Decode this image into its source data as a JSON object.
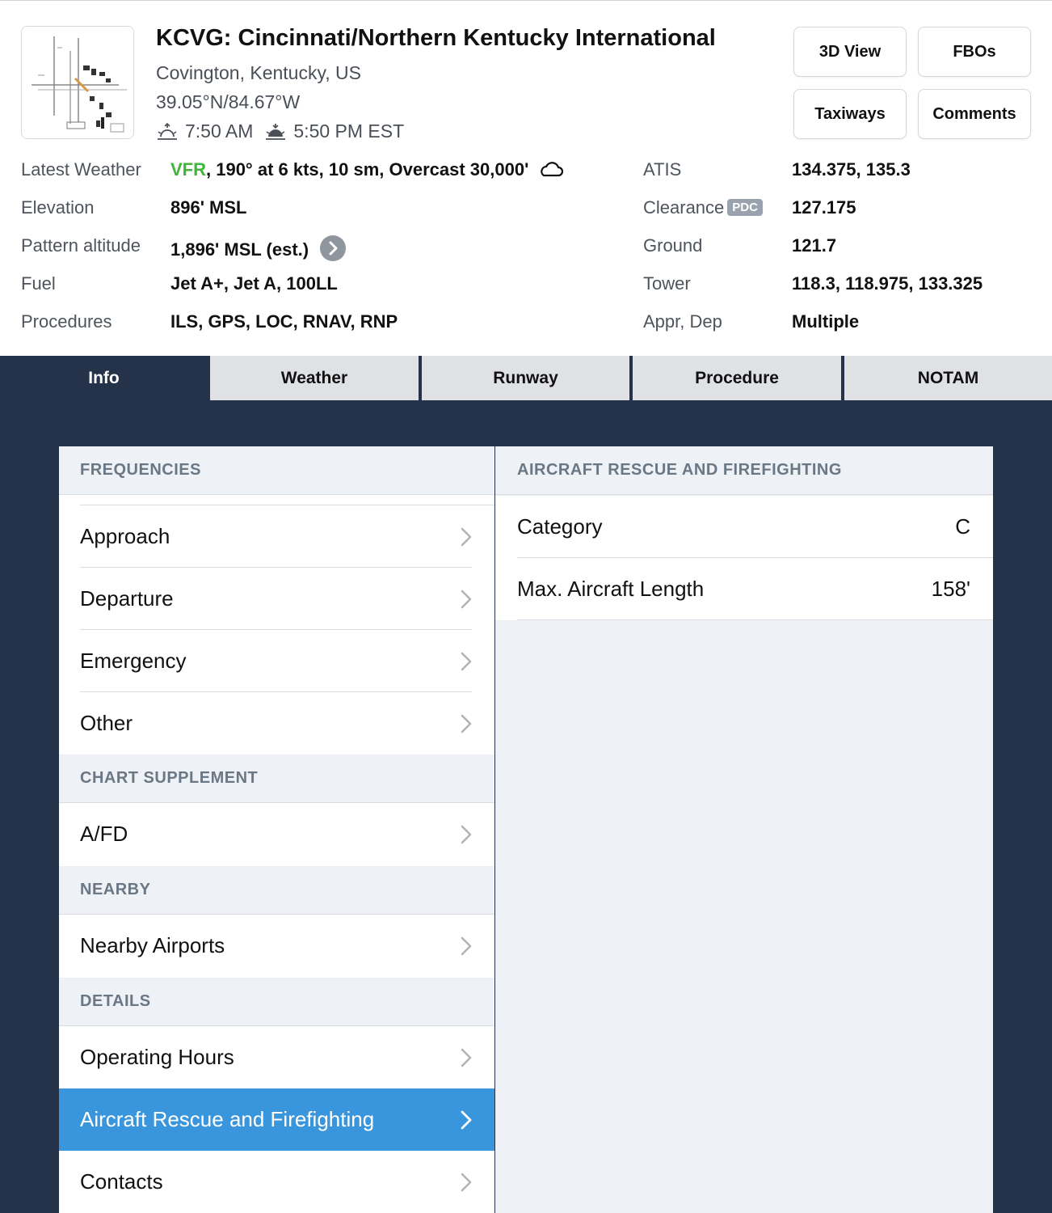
{
  "airport": {
    "title": "KCVG: Cincinnati/Northern Kentucky International",
    "location": "Covington, Kentucky, US",
    "coords": "39.05°N/84.67°W",
    "sunrise": "7:50 AM",
    "sunset": "5:50 PM EST"
  },
  "buttons": {
    "view3d": "3D View",
    "fbos": "FBOs",
    "taxiways": "Taxiways",
    "comments": "Comments"
  },
  "info": {
    "weather_label": "Latest Weather",
    "weather_flight_rule": "VFR",
    "weather_text": ", 190° at 6 kts, 10 sm, Overcast 30,000'",
    "elevation_label": "Elevation",
    "elevation_value": "896' MSL",
    "pattern_label": "Pattern altitude",
    "pattern_value": "1,896' MSL (est.)",
    "fuel_label": "Fuel",
    "fuel_value": "Jet A+, Jet A, 100LL",
    "procedures_label": "Procedures",
    "procedures_value": "ILS, GPS, LOC, RNAV, RNP",
    "atis_label": "ATIS",
    "atis_value": "134.375, 135.3",
    "clearance_label": "Clearance",
    "clearance_badge": "PDC",
    "clearance_value": "127.175",
    "ground_label": "Ground",
    "ground_value": "121.7",
    "tower_label": "Tower",
    "tower_value": "118.3, 118.975, 133.325",
    "apprdep_label": "Appr, Dep",
    "apprdep_value": "Multiple"
  },
  "tabs": [
    "Info",
    "Weather",
    "Runway",
    "Procedure",
    "NOTAM"
  ],
  "left": {
    "sec_frequencies": "FREQUENCIES",
    "approach": "Approach",
    "departure": "Departure",
    "emergency": "Emergency",
    "other": "Other",
    "sec_chart": "CHART SUPPLEMENT",
    "afd": "A/FD",
    "sec_nearby": "NEARBY",
    "nearby_airports": "Nearby Airports",
    "sec_details": "DETAILS",
    "operating_hours": "Operating Hours",
    "arff": "Aircraft Rescue and Firefighting",
    "contacts": "Contacts"
  },
  "right": {
    "header": "AIRCRAFT RESCUE AND FIREFIGHTING",
    "category_label": "Category",
    "category_value": "C",
    "length_label": "Max. Aircraft Length",
    "length_value": "158'"
  },
  "colors": {
    "vfr": "#3fb53a",
    "selected": "#3a96dc",
    "navy": "#25334a"
  }
}
